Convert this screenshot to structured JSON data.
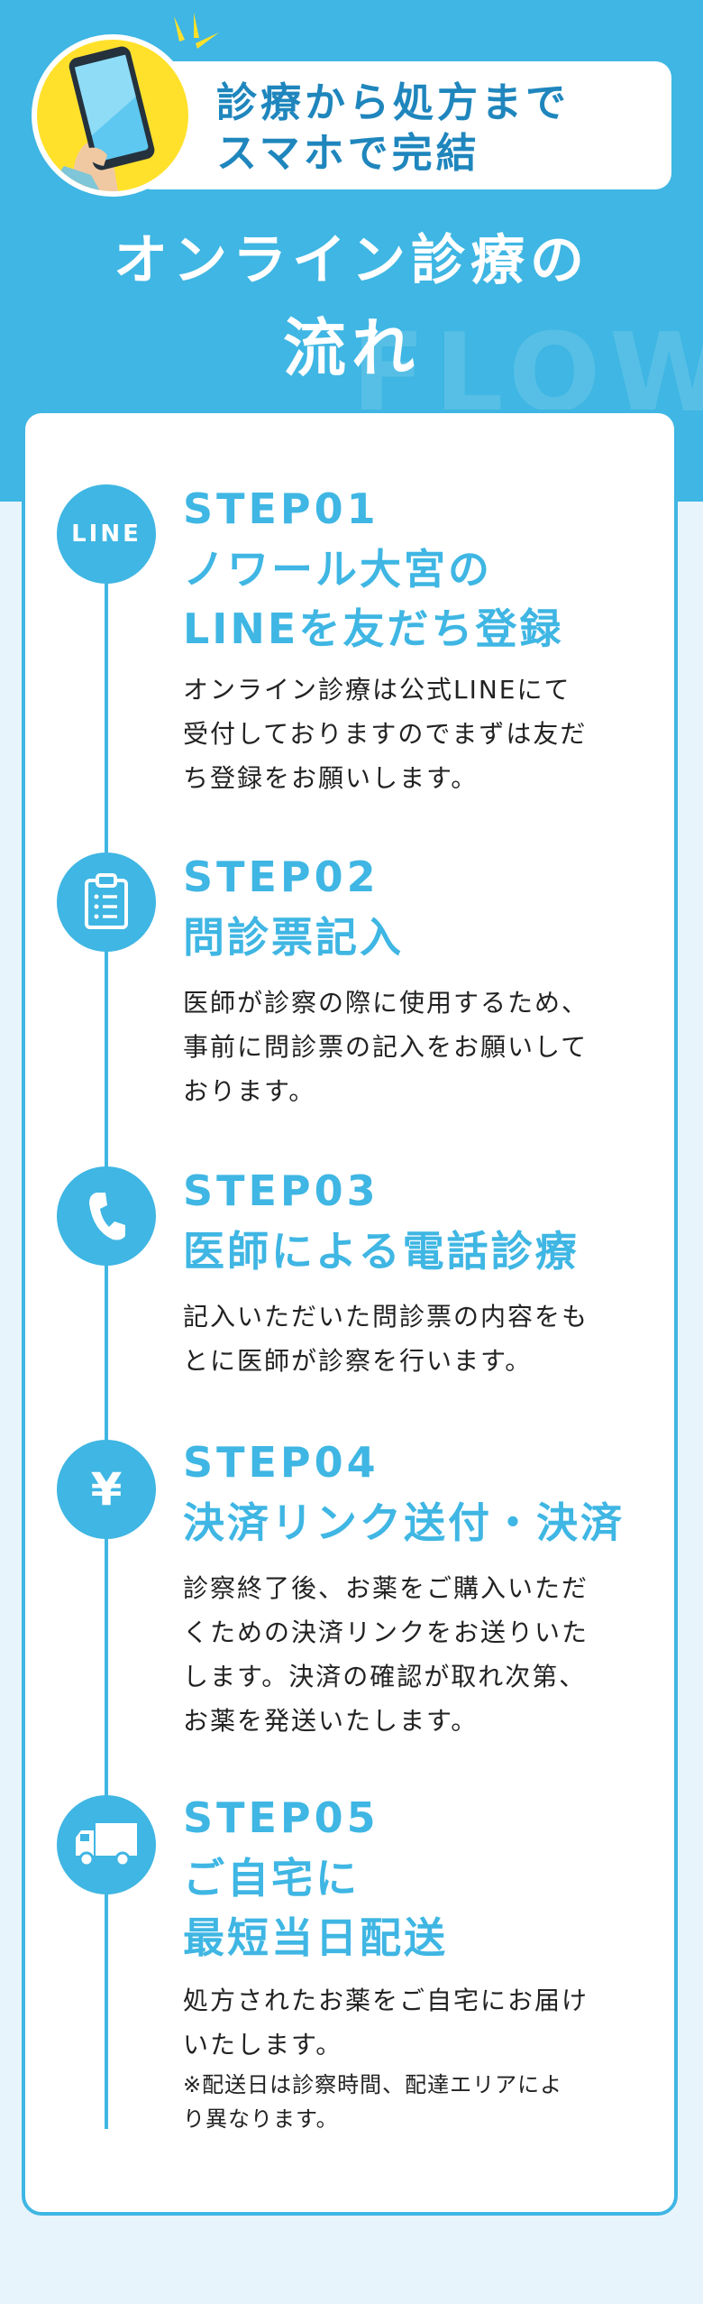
{
  "header": {
    "bubble_line1": "診療から処方まで",
    "bubble_line2": "スマホで完結",
    "title_line1": "オンライン診療の",
    "title_line2": "流れ",
    "watermark": "FLOW"
  },
  "colors": {
    "accent": "#3fb6e3",
    "bubble_text": "#1f86bd",
    "phone_bg": "#ffe12b",
    "page_bg": "#e8f4fb"
  },
  "steps": [
    {
      "label": "STEP01",
      "icon": "line-icon",
      "icon_text": "LINE",
      "title_line1": "ノワール大宮の",
      "title_line2": "LINEを友だち登録",
      "desc_line1": "オンライン診療は公式LINEにて",
      "desc_line2": "受付しておりますのでまずは友だ",
      "desc_line3": "ち登録をお願いします。"
    },
    {
      "label": "STEP02",
      "icon": "clipboard-icon",
      "title_line1": "問診票記入",
      "desc_line1": "医師が診察の際に使用するため、",
      "desc_line2": "事前に問診票の記入をお願いして",
      "desc_line3": "おります。"
    },
    {
      "label": "STEP03",
      "icon": "phone-icon",
      "title_line1": "医師による電話診療",
      "desc_line1": "記入いただいた問診票の内容をも",
      "desc_line2": "とに医師が診察を行います。"
    },
    {
      "label": "STEP04",
      "icon": "yen-icon",
      "icon_text": "¥",
      "title_line1": "決済リンク送付・決済",
      "desc_line1": "診察終了後、お薬をご購入いただ",
      "desc_line2": "くための決済リンクをお送りいた",
      "desc_line3": "します。決済の確認が取れ次第、",
      "desc_line4": "お薬を発送いたします。"
    },
    {
      "label": "STEP05",
      "icon": "truck-icon",
      "title_line1": "ご自宅に",
      "title_line2": "最短当日配送",
      "desc_line1": "処方されたお薬をご自宅にお届け",
      "desc_line2": "いたします。",
      "note_line1": "※配送日は診察時間、配達エリアによ",
      "note_line2": "り異なります。"
    }
  ]
}
